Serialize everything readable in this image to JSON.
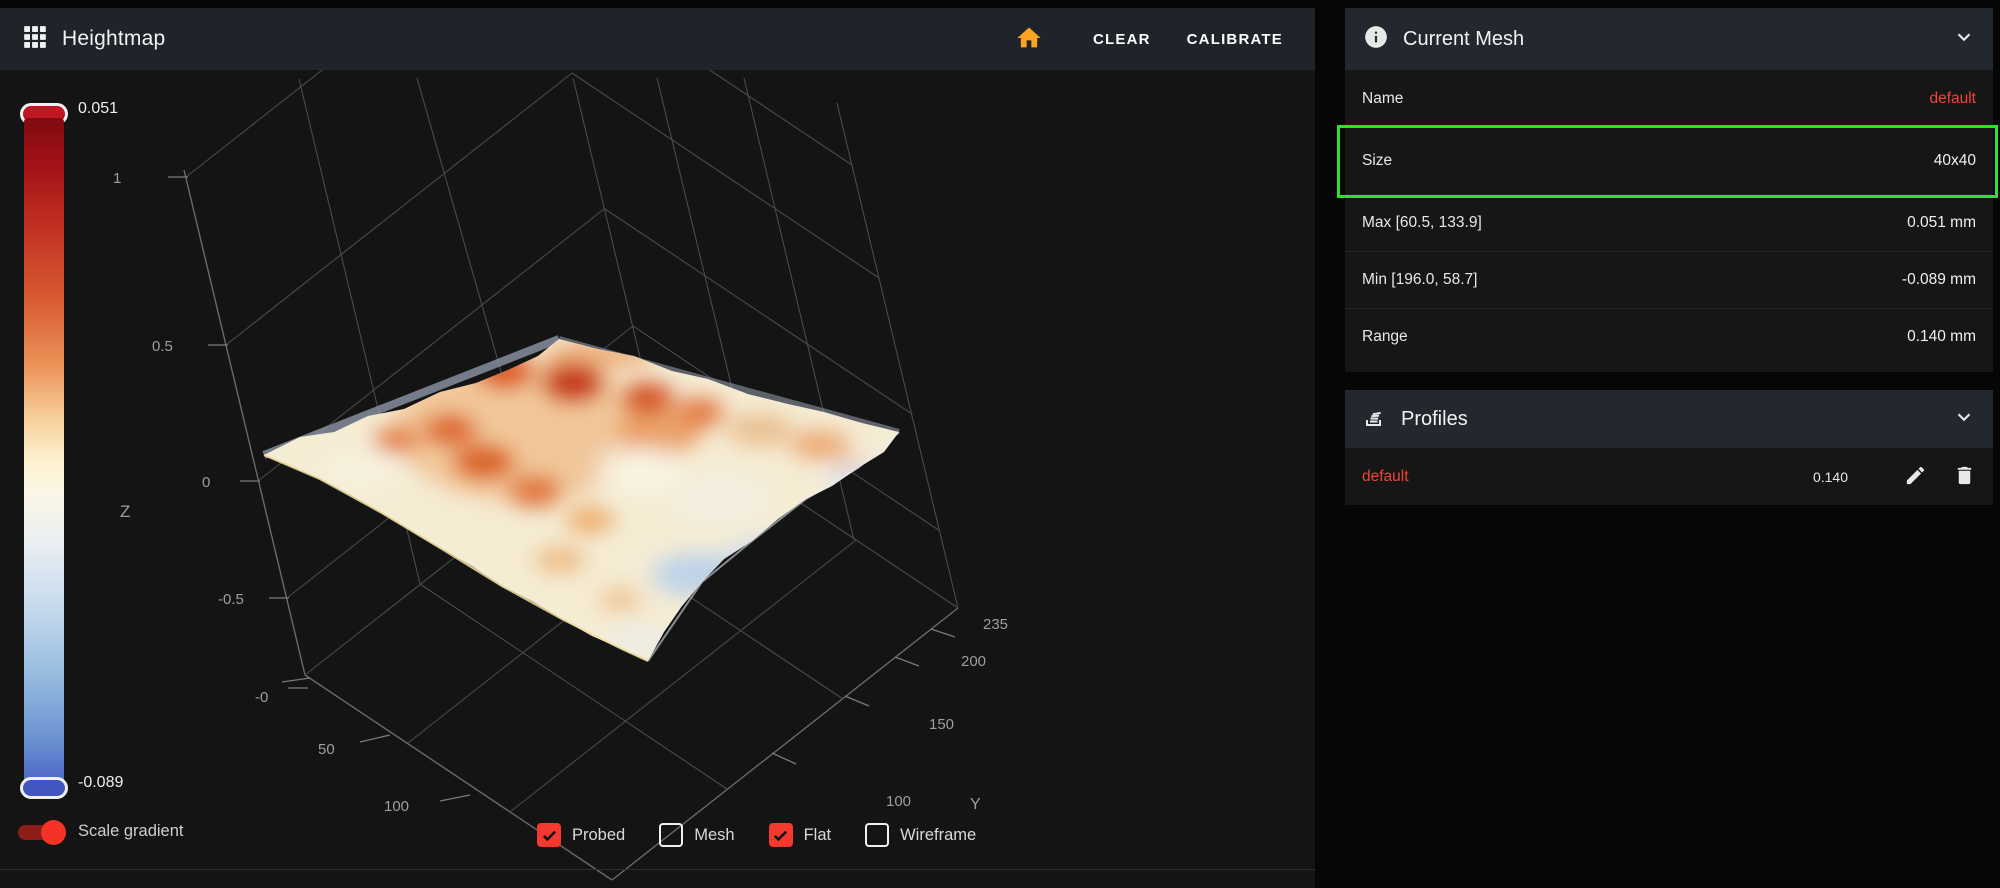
{
  "toolbar": {
    "title": "Heightmap",
    "clear_label": "CLEAR",
    "calibrate_label": "CALIBRATE"
  },
  "colorbar": {
    "max": "0.051",
    "min": "-0.089"
  },
  "plot": {
    "z_label": "Z",
    "z_ticks": [
      "1",
      "0.5",
      "0",
      "-0.5",
      "-0"
    ],
    "x_ticks": [
      "50",
      "100"
    ],
    "y_label": "Y",
    "y_ticks": [
      "100",
      "150",
      "200",
      "235"
    ]
  },
  "controls": {
    "scale_gradient_label": "Scale gradient",
    "toggles": [
      {
        "label": "Probed",
        "checked": true
      },
      {
        "label": "Mesh",
        "checked": false
      },
      {
        "label": "Flat",
        "checked": true
      },
      {
        "label": "Wireframe",
        "checked": false
      }
    ]
  },
  "current_mesh": {
    "title": "Current Mesh",
    "rows": [
      {
        "label": "Name",
        "value": "default"
      },
      {
        "label": "Size",
        "value": "40x40"
      },
      {
        "label": "Max [60.5, 133.9]",
        "value": "0.051 mm"
      },
      {
        "label": "Min [196.0, 58.7]",
        "value": "-0.089 mm"
      },
      {
        "label": "Range",
        "value": "0.140 mm"
      }
    ]
  },
  "profiles": {
    "title": "Profiles",
    "rows": [
      {
        "name": "default",
        "value": "0.140"
      }
    ]
  },
  "colors": {
    "accent_red": "#f44336",
    "highlight_green": "#2ae42a",
    "home_amber": "#fda324",
    "surface_max_red": "#c03012",
    "surface_min_blue": "#4a63c4"
  }
}
